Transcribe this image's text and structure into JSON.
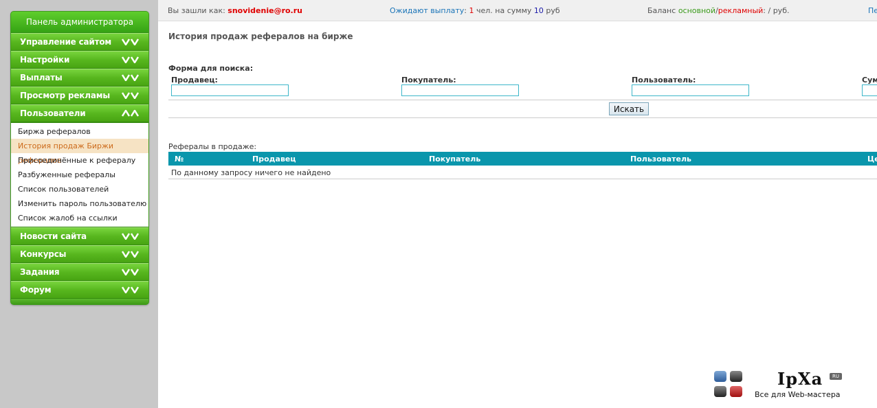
{
  "sidebar": {
    "title": "Панель администратора",
    "sections_top": [
      {
        "label": "Управление сайтом"
      },
      {
        "label": "Настройки"
      },
      {
        "label": "Выплаты"
      },
      {
        "label": "Просмотр рекламы"
      },
      {
        "label": "Пользователи"
      }
    ],
    "users_submenu": [
      {
        "label": "Биржа рефералов"
      },
      {
        "label": "История продаж Биржи рефералов",
        "active": true
      },
      {
        "label": "Присоединённые к рефералу"
      },
      {
        "label": "Разбуженные рефералы"
      },
      {
        "label": "Список пользователей"
      },
      {
        "label": "Изменить пароль пользователю"
      },
      {
        "label": "Список жалоб на ссылки"
      }
    ],
    "sections_bottom": [
      {
        "label": "Новости сайта"
      },
      {
        "label": "Конкурсы"
      },
      {
        "label": "Задания"
      },
      {
        "label": "Форум"
      }
    ]
  },
  "topbar": {
    "logged_label": "Вы зашли как:",
    "logged_user": "snovidenie@ro.ru",
    "pending_label": "Ожидают выплату",
    "pending_colon": ":",
    "pending_count": "1",
    "pending_mid": "чел. на сумму",
    "pending_sum": "10",
    "pending_currency": "руб",
    "balance_label": "Баланс",
    "balance_main": "основной",
    "balance_sep": "/",
    "balance_ad": "рекламный",
    "balance_tail": ": / руб.",
    "more_link": "Пе"
  },
  "main": {
    "title": "История продаж рефералов на бирже",
    "search_form_label": "Форма для поиска:",
    "fields": [
      {
        "label": "Продавец:",
        "value": ""
      },
      {
        "label": "Покупатель:",
        "value": ""
      },
      {
        "label": "Пользователь:",
        "value": ""
      },
      {
        "label": "Сумм",
        "value": ""
      }
    ],
    "search_button": "Искать",
    "refs_label": "Рефералы в продаже:",
    "table_headers": [
      "№",
      "Продавец",
      "Покупатель",
      "Пользователь",
      "Це"
    ],
    "empty_message": "По данному запросу ничего не найдено"
  },
  "logo": {
    "text": "IpXa",
    "badge": "RU",
    "subtitle": "Все для Web-мастера"
  },
  "colors": {
    "menu_green": "#5cb82d",
    "table_header": "#0a96ac",
    "active_item_bg": "#f6e3c4",
    "active_item_text": "#cc6a1a",
    "user_red": "#e00000"
  }
}
